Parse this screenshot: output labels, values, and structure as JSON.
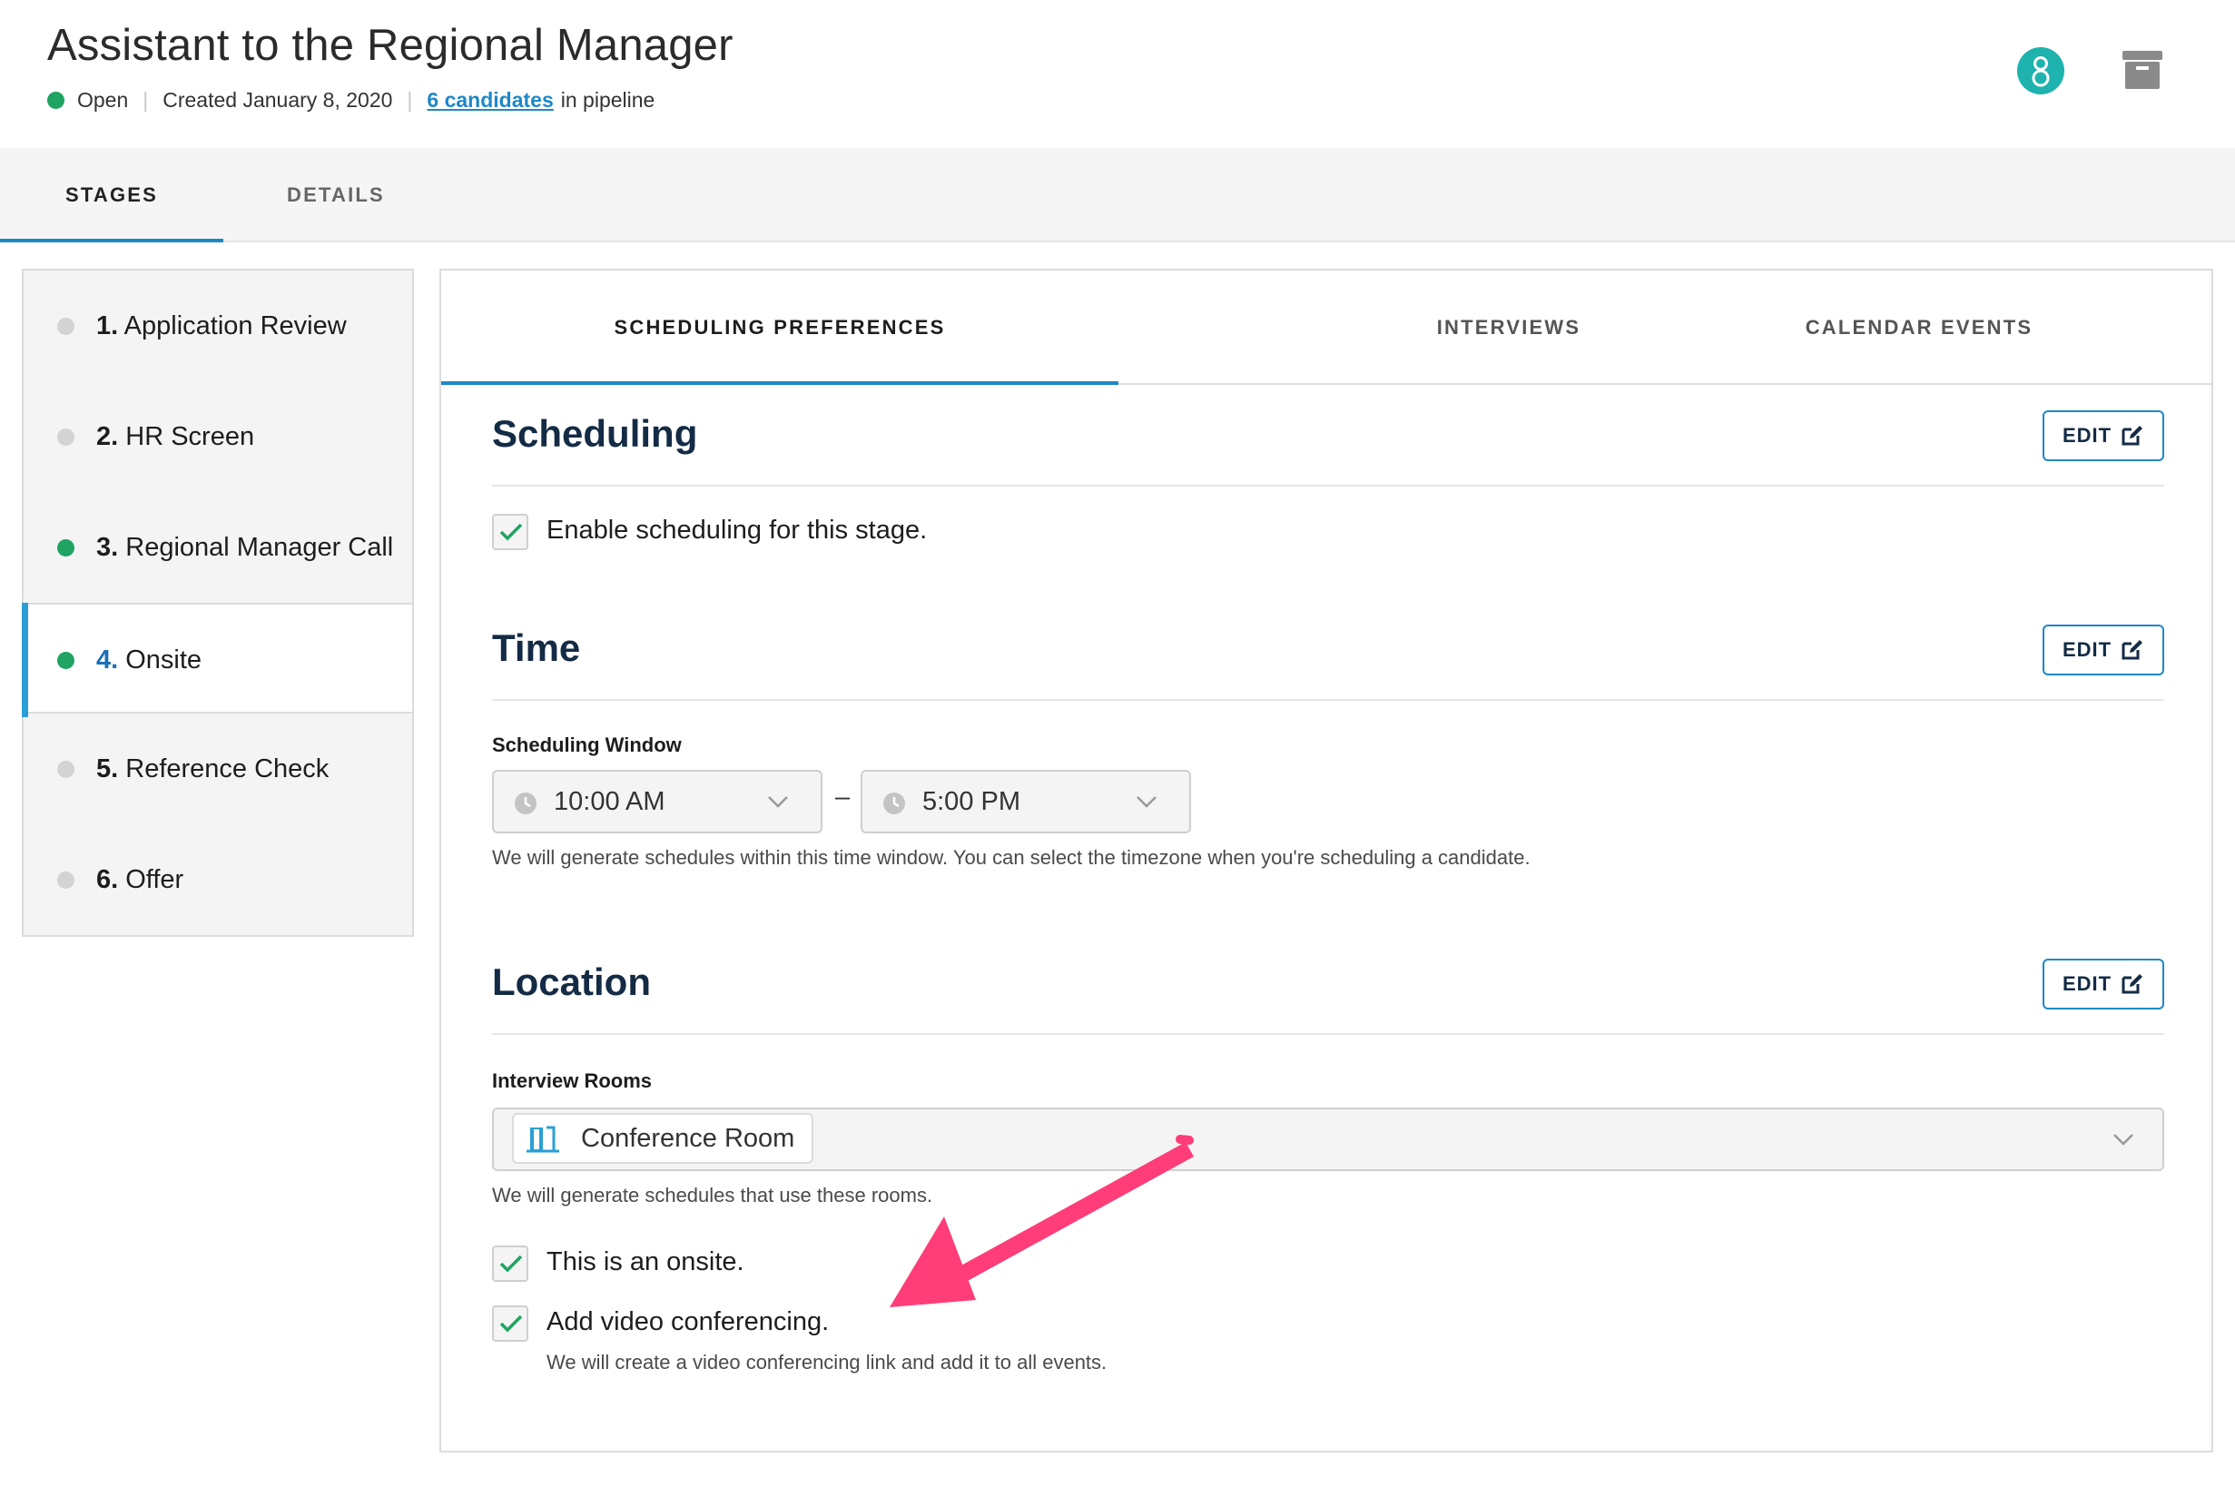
{
  "header": {
    "title": "Assistant to the Regional Manager",
    "status": "Open",
    "created": "Created January 8, 2020",
    "candidates_link": "6 candidates",
    "candidates_suffix": "in pipeline",
    "avatar_icon": "user-avatar-icon",
    "archive_icon": "archive-icon",
    "colors": {
      "status_green": "#1fa463",
      "avatar": "#1eb3ae",
      "accent": "#1e88c7"
    }
  },
  "top_tabs": [
    {
      "label": "STAGES",
      "active": true
    },
    {
      "label": "DETAILS",
      "active": false
    }
  ],
  "stages": [
    {
      "number": "1.",
      "name": "Application Review",
      "status": "grey"
    },
    {
      "number": "2.",
      "name": "HR Screen",
      "status": "grey"
    },
    {
      "number": "3.",
      "name": "Regional Manager Call",
      "status": "green"
    },
    {
      "number": "4.",
      "name": "Onsite",
      "status": "green",
      "active": true
    },
    {
      "number": "5.",
      "name": "Reference Check",
      "status": "grey"
    },
    {
      "number": "6.",
      "name": "Offer",
      "status": "grey"
    }
  ],
  "sub_tabs": [
    {
      "label": "SCHEDULING PREFERENCES",
      "active": true
    },
    {
      "label": "INTERVIEWS",
      "active": false
    },
    {
      "label": "CALENDAR EVENTS",
      "active": false
    }
  ],
  "scheduling": {
    "title": "Scheduling",
    "edit_label": "EDIT",
    "enable_label": "Enable scheduling for this stage.",
    "enable_checked": true
  },
  "time": {
    "title": "Time",
    "edit_label": "EDIT",
    "window_label": "Scheduling Window",
    "start": "10:00 AM",
    "separator": "–",
    "end": "5:00 PM",
    "help": "We will generate schedules within this time window. You can select the timezone when you're scheduling a candidate."
  },
  "location": {
    "title": "Location",
    "edit_label": "EDIT",
    "rooms_label": "Interview Rooms",
    "room_chip": "Conference Room",
    "rooms_help": "We will generate schedules that use these rooms.",
    "onsite_label": "This is an onsite.",
    "onsite_checked": true,
    "video_label": "Add video conferencing.",
    "video_checked": true,
    "video_help": "We will create a video conferencing link and add it to all events."
  },
  "annotation": {
    "color": "#ff3d78"
  }
}
